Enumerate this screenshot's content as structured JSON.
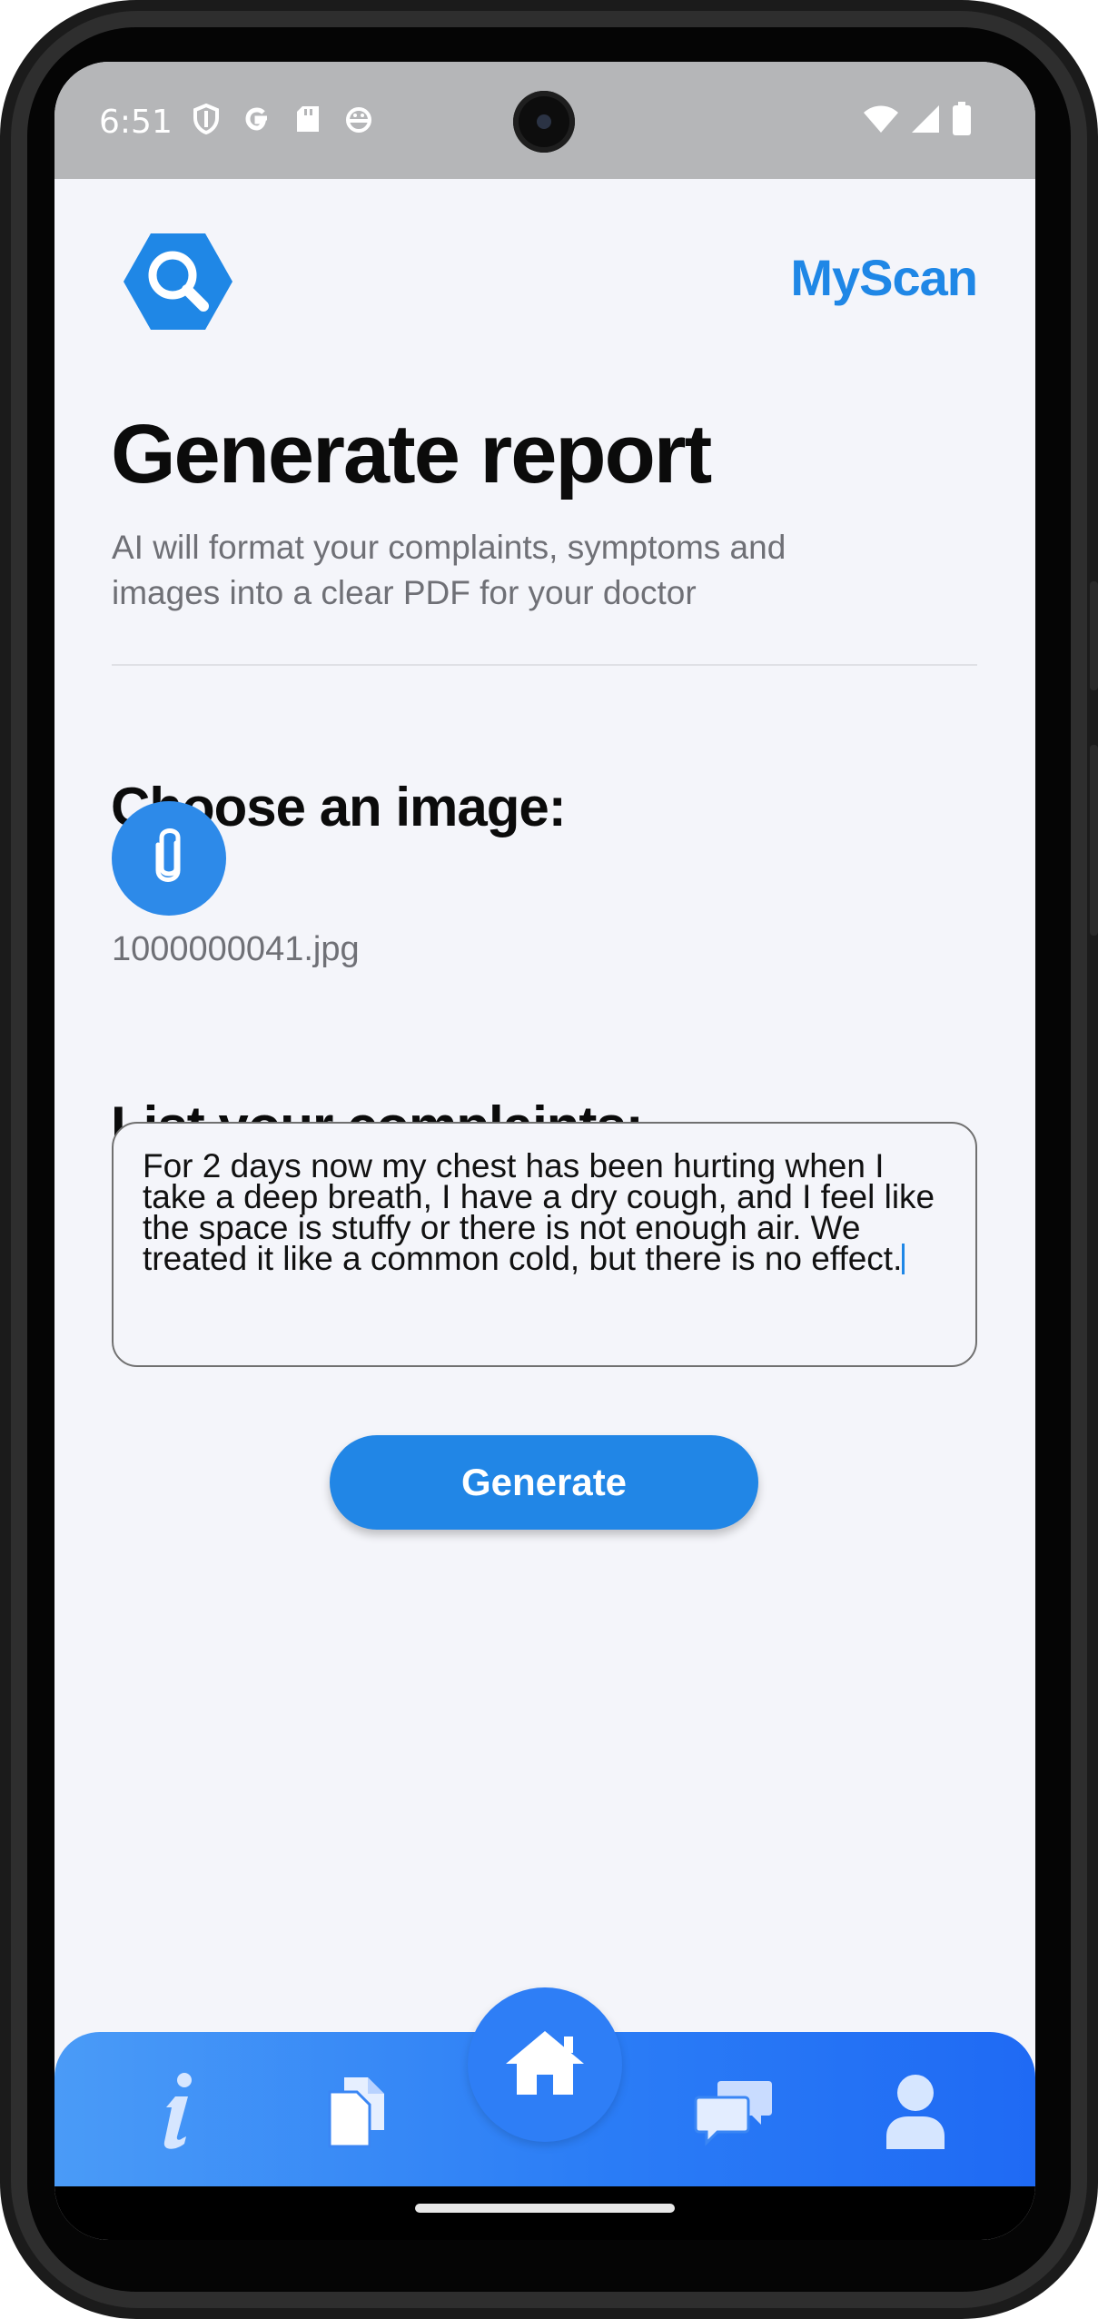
{
  "status_bar": {
    "time": "6:51",
    "left_icons": [
      "shield-icon",
      "google-icon",
      "sd-card-icon",
      "android-icon"
    ],
    "right_icons": [
      "wifi-icon",
      "signal-icon",
      "battery-icon"
    ]
  },
  "header": {
    "logo_icon": "search-hexagon-logo-icon",
    "brand": "MyScan"
  },
  "page": {
    "title": "Generate report",
    "subtitle": "AI will format your complaints, symptoms and images into a clear PDF for your doctor"
  },
  "image_section": {
    "title": "Choose an image:",
    "attach_icon": "paperclip-icon",
    "filename": "1000000041.jpg"
  },
  "complaints_section": {
    "title": "List your complaints:",
    "value": "For 2 days now my chest has been hurting when I take a deep breath, I have a dry cough, and I feel like the space is stuffy or there is not enough air. We treated it like a common cold, but there is no effect."
  },
  "generate_button": {
    "label": "Generate"
  },
  "bottom_nav": {
    "items": [
      {
        "icon": "info-icon"
      },
      {
        "icon": "documents-icon"
      },
      {
        "icon": "home-icon",
        "active": true
      },
      {
        "icon": "chat-icon"
      },
      {
        "icon": "profile-icon"
      }
    ]
  },
  "colors": {
    "accent": "#2186e6",
    "brand": "#1f87e6",
    "background": "#f4f5fa",
    "nav_start": "#4a9bf7",
    "nav_end": "#1f6af4"
  }
}
